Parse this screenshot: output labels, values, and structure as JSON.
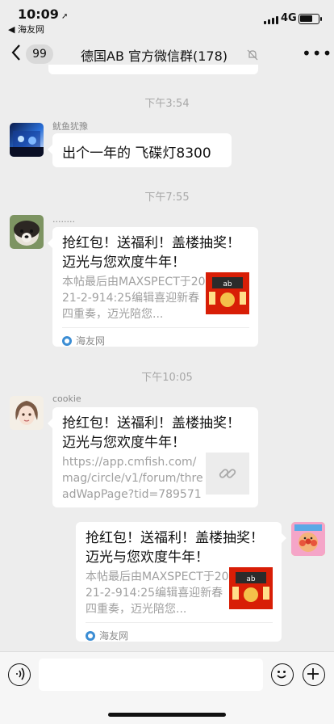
{
  "status_bar": {
    "time": "10:09",
    "back_app": "◀ 海友网",
    "network": "4G"
  },
  "nav": {
    "back_count": "99",
    "title": "德国AB 官方微信群(178)",
    "icons": [
      "back-chevron-icon",
      "mute-bell-icon",
      "more-dots-icon"
    ]
  },
  "messages": [
    {
      "timestamp": "下午3:54",
      "sender": "鱿鱼犹豫",
      "text": "出个一年的 飞碟灯8300"
    },
    {
      "timestamp": "下午7:55",
      "sender": "........",
      "card": {
        "title": "抢红包！送福利！盖楼抽奖！迈光与您欢度牛年！",
        "desc": "本帖最后由MAXSPECT于2021-2-914:25编辑喜迎新春四重奏，迈光陪您...",
        "source": "海友网"
      }
    },
    {
      "timestamp": "下午10:05",
      "sender": "cookie",
      "card": {
        "title": "抢红包！送福利！盖楼抽奖！迈光与您欢度牛年！",
        "desc": "https://app.cmfish.com/mag/circle/v1/forum/threadWapPage?tid=789571&..."
      }
    },
    {
      "sender": "me",
      "card": {
        "title": "抢红包！送福利！盖楼抽奖！迈光与您欢度牛年！",
        "desc": "本帖最后由MAXSPECT于2021-2-914:25编辑喜迎新春四重奏，迈光陪您...",
        "source": "海友网"
      }
    }
  ],
  "input_bar": {
    "placeholder": "",
    "icons": [
      "voice-icon",
      "emoji-icon",
      "plus-icon"
    ]
  },
  "colors": {
    "background": "#ededed",
    "bubble": "#ffffff",
    "timestamp": "#a7a7a7",
    "red_thumb": "#d81e06"
  }
}
